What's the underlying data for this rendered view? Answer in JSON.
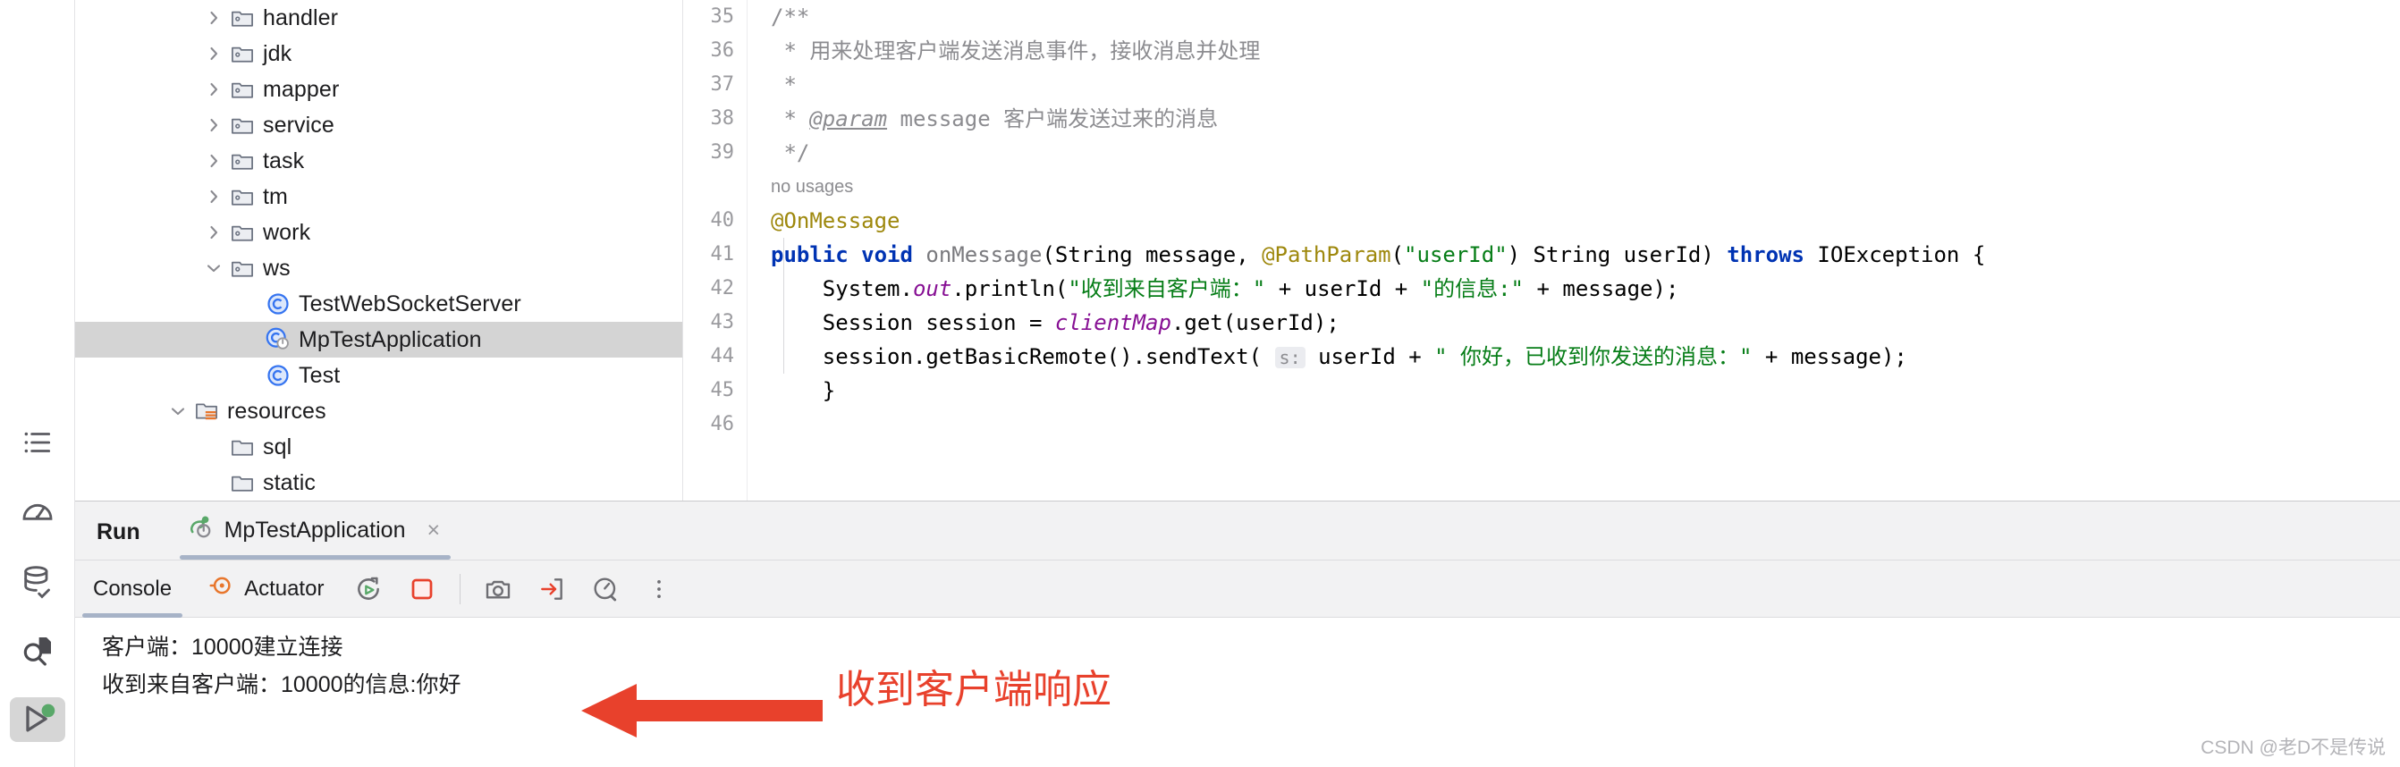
{
  "colors": {
    "accent_blue": "#3574f0",
    "keyword_blue": "#0033b3",
    "string_green": "#067d17",
    "annotation_olive": "#9e880d",
    "field_purple": "#871094",
    "comment_gray": "#8c8c90",
    "annotation_red": "#e8412c",
    "selection_gray": "#d4d4d4",
    "tab_underline": "#a7b3c7",
    "resources_orange": "#e8762c",
    "run_green": "#59a869"
  },
  "tool_strip": {
    "items": [
      {
        "name": "structure-icon",
        "label": "Structure"
      },
      {
        "name": "endpoints-icon",
        "label": "Endpoints"
      },
      {
        "name": "database-icon",
        "label": "Database"
      },
      {
        "name": "search-everywhere-icon",
        "label": "Find"
      },
      {
        "name": "run-icon",
        "label": "Run",
        "active": true
      }
    ]
  },
  "project_tree": {
    "rows": [
      {
        "label": "handler",
        "indent": 2,
        "chevron": "right",
        "icon": "package-folder-icon",
        "selected": false
      },
      {
        "label": "jdk",
        "indent": 2,
        "chevron": "right",
        "icon": "package-folder-icon",
        "selected": false
      },
      {
        "label": "mapper",
        "indent": 2,
        "chevron": "right",
        "icon": "package-folder-icon",
        "selected": false
      },
      {
        "label": "service",
        "indent": 2,
        "chevron": "right",
        "icon": "package-folder-icon",
        "selected": false
      },
      {
        "label": "task",
        "indent": 2,
        "chevron": "right",
        "icon": "package-folder-icon",
        "selected": false
      },
      {
        "label": "tm",
        "indent": 2,
        "chevron": "right",
        "icon": "package-folder-icon",
        "selected": false
      },
      {
        "label": "work",
        "indent": 2,
        "chevron": "right",
        "icon": "package-folder-icon",
        "selected": false
      },
      {
        "label": "ws",
        "indent": 2,
        "chevron": "down",
        "icon": "package-folder-icon",
        "selected": false
      },
      {
        "label": "TestWebSocketServer",
        "indent": 3,
        "chevron": "none",
        "icon": "java-class-icon",
        "selected": false
      },
      {
        "label": "MpTestApplication",
        "indent": 3,
        "chevron": "none",
        "icon": "java-class-run-icon",
        "selected": true
      },
      {
        "label": "Test",
        "indent": 3,
        "chevron": "none",
        "icon": "java-class-icon",
        "selected": false
      },
      {
        "label": "resources",
        "indent": 1,
        "chevron": "down",
        "icon": "resources-root-icon",
        "selected": false
      },
      {
        "label": "sql",
        "indent": 2,
        "chevron": "none",
        "icon": "folder-icon",
        "selected": false
      },
      {
        "label": "static",
        "indent": 2,
        "chevron": "none",
        "icon": "folder-icon",
        "selected": false
      }
    ]
  },
  "editor": {
    "line_numbers": [
      "35",
      "36",
      "37",
      "38",
      "39",
      "",
      "40",
      "41",
      "42",
      "43",
      "44",
      "45",
      "46"
    ],
    "lines": [
      {
        "num": "35",
        "kind": "code",
        "tokens": [
          {
            "t": "/**",
            "c": "tok-doc"
          }
        ]
      },
      {
        "num": "36",
        "kind": "code",
        "tokens": [
          {
            "t": " * 用来处理客户端发送消息事件，接收消息并处理",
            "c": "tok-doc"
          }
        ]
      },
      {
        "num": "37",
        "kind": "code",
        "tokens": [
          {
            "t": " *",
            "c": "tok-doc"
          }
        ]
      },
      {
        "num": "38",
        "kind": "code",
        "tokens": [
          {
            "t": " * ",
            "c": "tok-doc"
          },
          {
            "t": "@param",
            "c": "tok-tag"
          },
          {
            "t": " message",
            "c": "tok-doc"
          },
          {
            "t": " 客户端发送过来的消息",
            "c": "tok-doc"
          }
        ]
      },
      {
        "num": "39",
        "kind": "code",
        "tokens": [
          {
            "t": " */",
            "c": "tok-doc"
          }
        ]
      },
      {
        "num": "",
        "kind": "inlay",
        "text": "no usages"
      },
      {
        "num": "40",
        "kind": "code",
        "tokens": [
          {
            "t": "@OnMessage",
            "c": "tok-ann"
          }
        ]
      },
      {
        "num": "41",
        "kind": "code",
        "tokens": [
          {
            "t": "public void",
            "c": "tok-kw"
          },
          {
            "t": " ",
            "c": "tok-pln"
          },
          {
            "t": "onMessage",
            "c": "tok-mth"
          },
          {
            "t": "(String message, ",
            "c": "tok-pln"
          },
          {
            "t": "@PathParam",
            "c": "tok-ann"
          },
          {
            "t": "(",
            "c": "tok-pln"
          },
          {
            "t": "\"userId\"",
            "c": "tok-str"
          },
          {
            "t": ") String userId) ",
            "c": "tok-pln"
          },
          {
            "t": "throws",
            "c": "tok-kw"
          },
          {
            "t": " IOException {",
            "c": "tok-pln"
          }
        ]
      },
      {
        "num": "42",
        "kind": "code",
        "tokens": [
          {
            "t": "    System.",
            "c": "tok-pln"
          },
          {
            "t": "out",
            "c": "tok-fld"
          },
          {
            "t": ".println(",
            "c": "tok-pln"
          },
          {
            "t": "\"收到来自客户端：\"",
            "c": "tok-str"
          },
          {
            "t": " + userId + ",
            "c": "tok-pln"
          },
          {
            "t": "\"的信息:\"",
            "c": "tok-str"
          },
          {
            "t": " + message);",
            "c": "tok-pln"
          }
        ]
      },
      {
        "num": "43",
        "kind": "code",
        "tokens": [
          {
            "t": "    Session session = ",
            "c": "tok-pln"
          },
          {
            "t": "clientMap",
            "c": "tok-fld"
          },
          {
            "t": ".get(userId);",
            "c": "tok-pln"
          }
        ]
      },
      {
        "num": "44",
        "kind": "code",
        "tokens": [
          {
            "t": "    session.getBasicRemote().sendText( ",
            "c": "tok-pln"
          },
          {
            "t": "s:",
            "c": "hintchip"
          },
          {
            "t": " userId + ",
            "c": "tok-pln"
          },
          {
            "t": "\" 你好，已收到你发送的消息：\"",
            "c": "tok-str"
          },
          {
            "t": " + message);",
            "c": "tok-pln"
          }
        ]
      },
      {
        "num": "45",
        "kind": "code",
        "tokens": [
          {
            "t": "    }",
            "c": "tok-pln"
          }
        ]
      },
      {
        "num": "46",
        "kind": "code",
        "tokens": []
      }
    ]
  },
  "run_window": {
    "title": "Run",
    "tab": {
      "label": "MpTestApplication",
      "icon": "spring-boot-icon",
      "close": "×",
      "active": true
    },
    "toolbar": {
      "console_label": "Console",
      "actuator_label": "Actuator",
      "buttons": [
        {
          "name": "rerun-button",
          "title": "Rerun"
        },
        {
          "name": "stop-button",
          "title": "Stop"
        },
        {
          "name": "screenshot-button",
          "title": "Capture"
        },
        {
          "name": "export-button",
          "title": "Export"
        },
        {
          "name": "profiler-button",
          "title": "Profiler"
        },
        {
          "name": "more-options-button",
          "title": "More"
        }
      ]
    },
    "gutter": {
      "up_label": "↑",
      "down_label": "↓"
    },
    "console_lines": [
      "客户端：10000建立连接",
      "收到来自客户端：10000的信息:你好"
    ]
  },
  "annotation": {
    "text": "收到客户端响应",
    "arrow_name": "red-arrow-annotation"
  },
  "watermark": {
    "text": "CSDN @老D不是传说"
  }
}
